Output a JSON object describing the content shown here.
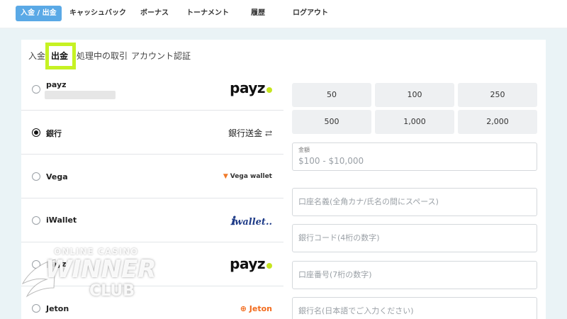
{
  "nav": {
    "items": [
      {
        "label": "入金 / 出金",
        "active": true
      },
      {
        "label": "キャッシュバック"
      },
      {
        "label": "ボーナス"
      },
      {
        "label": "トーナメント"
      },
      {
        "label": "履歴"
      },
      {
        "label": "ログアウト"
      }
    ]
  },
  "subtabs": [
    {
      "label": "入金"
    },
    {
      "label": "出金",
      "active": true
    },
    {
      "label": "処理中の取引"
    },
    {
      "label": "アカウント認証"
    }
  ],
  "payment_methods": [
    {
      "name": "payz",
      "logo": "payz",
      "selected": false
    },
    {
      "name": "銀行",
      "logo": "銀行送金",
      "selected": true
    },
    {
      "name": "Vega",
      "logo": "Vega wallet",
      "selected": false
    },
    {
      "name": "iWallet",
      "logo": "wallet..",
      "selected": false
    },
    {
      "name": "payz",
      "logo": "payz",
      "selected": false
    },
    {
      "name": "Jeton",
      "logo": "Jeton",
      "selected": false
    }
  ],
  "amounts": [
    "50",
    "100",
    "250",
    "500",
    "1,000",
    "2,000"
  ],
  "form": {
    "amount_label": "金額",
    "amount_placeholder": "$100 - $10,000",
    "account_name_placeholder": "口座名義(全角カナ/氏名の間にスペース)",
    "bank_code_placeholder": "銀行コード(4桁の数字)",
    "account_number_placeholder": "口座番号(7桁の数字)",
    "bank_name_placeholder": "銀行名(日本語でご入力ください)"
  },
  "watermark": {
    "line1": "ONLINE CASINO",
    "line2": "WINNER",
    "line3": "CLUB"
  },
  "colors": {
    "nav_active": "#5aa9e6",
    "highlight": "#c6f223",
    "page_bg": "#eaf3f6",
    "payz_dot": "#c6e51f",
    "jeton": "#f26b1d"
  }
}
